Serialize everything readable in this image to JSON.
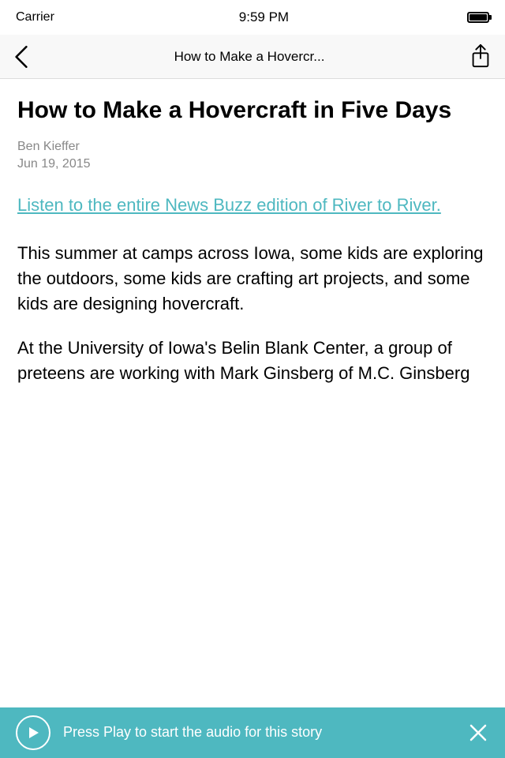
{
  "statusBar": {
    "carrier": "Carrier",
    "time": "9:59 PM"
  },
  "navBar": {
    "title": "How to Make a Hovercr...",
    "backLabel": "Back"
  },
  "article": {
    "title": "How to Make a Hovercraft in Five Days",
    "author": "Ben Kieffer",
    "date": "Jun 19, 2015",
    "link": "Listen to the entire News Buzz edition of River to River.",
    "body1": "This summer at camps across Iowa, some kids are exploring the outdoors, some kids are crafting art projects, and some kids are designing hovercraft.",
    "body2": "At the University of Iowa's Belin Blank Center, a group of preteens are working with Mark Ginsberg of M.C. Ginsberg"
  },
  "player": {
    "text": "Press Play to start the audio for this story"
  }
}
